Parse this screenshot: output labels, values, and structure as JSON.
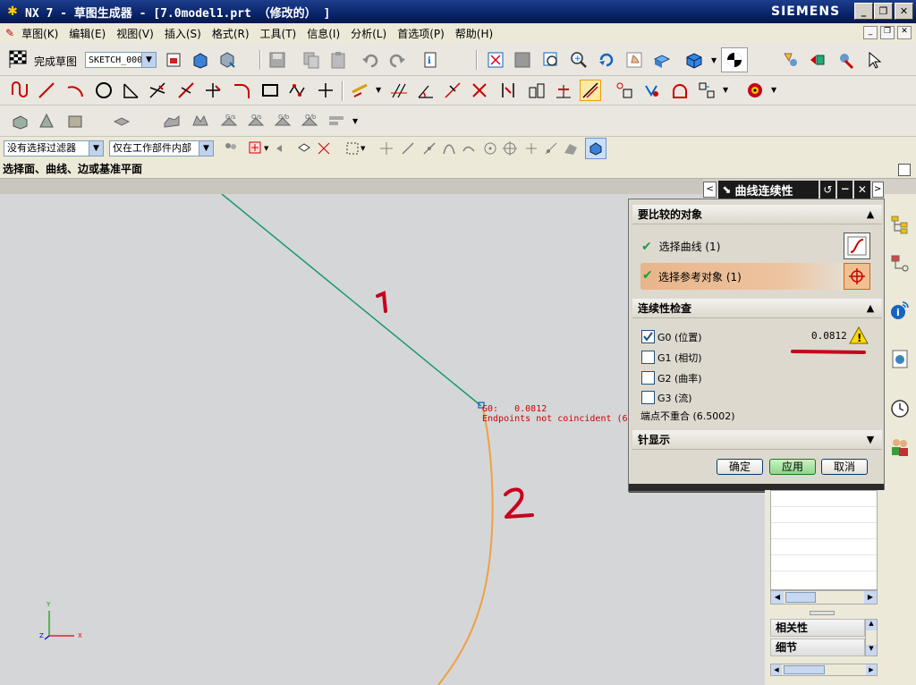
{
  "window": {
    "title": "NX 7 - 草图生成器 - [7.0model1.prt （修改的） ]",
    "brand": "SIEMENS",
    "minimize": "_",
    "restore": "❐",
    "close": "✕"
  },
  "menu": [
    "草图(K)",
    "编辑(E)",
    "视图(V)",
    "插入(S)",
    "格式(R)",
    "工具(T)",
    "信息(I)",
    "分析(L)",
    "首选项(P)",
    "帮助(H)"
  ],
  "toolbar": {
    "finish_sketch": "完成草图",
    "sketch_name": "SKETCH_000"
  },
  "filters": {
    "type_filter": "没有选择过滤器",
    "scope_filter": "仅在工作部件内部"
  },
  "status": "选择面、曲线、边或基准平面",
  "canvas": {
    "annotation_1": "1",
    "annotation_2": "2",
    "g0_readout": "G0:   0.0812",
    "endpoints_msg": "Endpoints not coincident (6",
    "axis_y": "Y",
    "axis_x": "X",
    "axis_z": "Z"
  },
  "dialog": {
    "title": "曲线连续性",
    "section_objects": "要比较的对象",
    "select_curve": "选择曲线 (1)",
    "select_ref": "选择参考对象 (1)",
    "section_check": "连续性检查",
    "g0": "G0 (位置)",
    "g0_value": "0.0812",
    "g1": "G1 (相切)",
    "g2": "G2 (曲率)",
    "g3": "G3 (流)",
    "endpoints": "端点不重合 (6.5002)",
    "section_display": "针显示",
    "ok": "确定",
    "apply": "应用",
    "cancel": "取消"
  },
  "side_panel": {
    "relations": "相关性",
    "details": "细节"
  },
  "colors": {
    "curve1": "#1a9a6a",
    "curve2": "#f0a040",
    "annotation": "#c8001c",
    "highlight_row": "#e9b58a"
  }
}
